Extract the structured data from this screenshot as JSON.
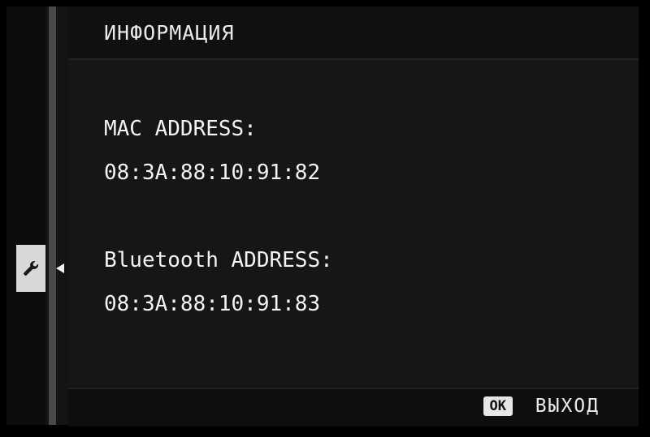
{
  "header": {
    "title": "ИНФОРМАЦИЯ"
  },
  "info": [
    {
      "label": "MAC ADDRESS:",
      "value": "08:3A:88:10:91:82"
    },
    {
      "label": "Bluetooth ADDRESS:",
      "value": "08:3A:88:10:91:83"
    }
  ],
  "sidebar": {
    "active_tab_icon": "wrench-icon",
    "pointer_icon": "triangle-left-icon"
  },
  "footer": {
    "ok_badge": "OK",
    "exit_label": "ВЫХОД"
  },
  "colors": {
    "background": "#141414",
    "text": "#f2f2f2",
    "tab_highlight": "#d8d8d8"
  }
}
